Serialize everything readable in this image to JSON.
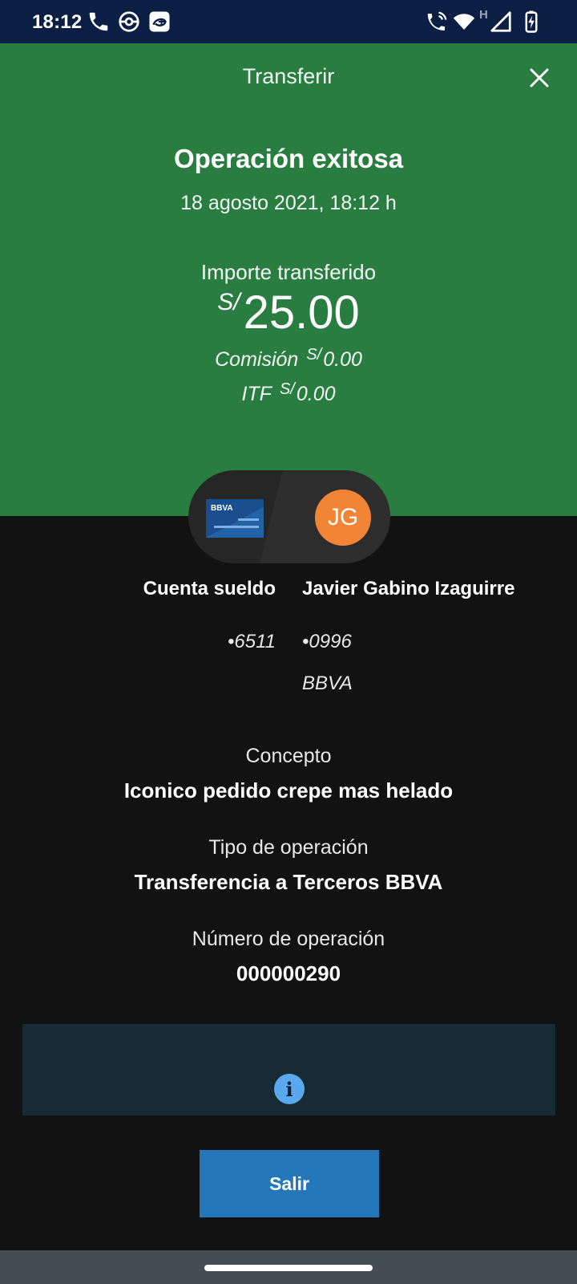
{
  "status_bar": {
    "time": "18:12",
    "left_icons": [
      "phone-icon",
      "pokeball-icon",
      "disney-plus-icon"
    ],
    "right_icons": [
      "wifi-call-icon",
      "wifi-icon",
      "network-h-icon",
      "signal-icon",
      "battery-charging-icon"
    ],
    "network_label": "H"
  },
  "header": {
    "title": "Transferir",
    "close_icon": "close-icon",
    "background": "#2a7d40"
  },
  "result": {
    "title": "Operación exitosa",
    "date": "18 agosto 2021, 18:12 h",
    "amount_label": "Importe transferido",
    "currency": "S/",
    "amount": "25.00",
    "commission_label": "Comisión",
    "commission_value": "0.00",
    "itf_label": "ITF",
    "itf_value": "0.00"
  },
  "accounts": {
    "origin": {
      "name": "Cuenta sueldo",
      "number": "•6511",
      "card_brand": "BBVA"
    },
    "destination": {
      "name": "Javier Gabino Izaguirre",
      "number": "•0996",
      "bank": "BBVA",
      "initials": "JG"
    }
  },
  "details": {
    "concept_label": "Concepto",
    "concept_value": "Iconico pedido crepe mas helado",
    "operation_type_label": "Tipo de operación",
    "operation_type_value": "Transferencia a Terceros BBVA",
    "operation_number_label": "Número de operación",
    "operation_number_value": "000000290"
  },
  "info_box": {
    "icon": "info-icon",
    "icon_text": "i"
  },
  "actions": {
    "exit_label": "Salir"
  },
  "colors": {
    "accent_green": "#2a7d40",
    "button_blue": "#2477b9",
    "avatar_orange": "#f18535",
    "status_bar": "#0b1f44",
    "info_box": "#172b36"
  }
}
